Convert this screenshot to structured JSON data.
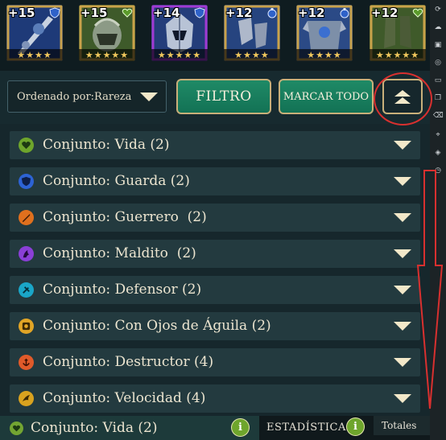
{
  "gear_items": [
    {
      "level": "+15",
      "stars": "★★★★",
      "set_icon": "shield-icon",
      "set_color": "#2f62c9",
      "frame": "#c9a24a"
    },
    {
      "level": "+15",
      "stars": "★★★★★",
      "set_icon": "heart-icon",
      "set_color": "#5b9a2b",
      "frame": "#c9a24a"
    },
    {
      "level": "+14",
      "stars": "★★★★★",
      "set_icon": "shield-icon",
      "set_color": "#2f62c9",
      "frame": "#a13ad1"
    },
    {
      "level": "+12",
      "stars": "★★★★",
      "set_icon": "potion-icon",
      "set_color": "#2f62c9",
      "frame": "#c9a24a"
    },
    {
      "level": "+12",
      "stars": "★★★★",
      "set_icon": "potion-icon",
      "set_color": "#2f62c9",
      "frame": "#c9a24a"
    },
    {
      "level": "+12",
      "stars": "★★★★★",
      "set_icon": "heart-icon",
      "set_color": "#5b9a2b",
      "frame": "#c9a24a"
    }
  ],
  "controls": {
    "sort_label": "Ordenado por:Rareza",
    "filter_label": "FILTRO",
    "mark_all_label": "MARCAR TODO"
  },
  "sets": [
    {
      "label": "Conjunto: Vida (2)",
      "icon": "heart-icon",
      "color": "#6ea52c"
    },
    {
      "label": "Conjunto: Guarda (2)",
      "icon": "shield-icon",
      "color": "#2d63d4"
    },
    {
      "label": "Conjunto: Guerrero  (2)",
      "icon": "sword-icon",
      "color": "#e0701e"
    },
    {
      "label": "Conjunto: Maldito  (2)",
      "icon": "curse-icon",
      "color": "#8a3fd6"
    },
    {
      "label": "Conjunto: Defensor (2)",
      "icon": "defender-icon",
      "color": "#1aa6c8"
    },
    {
      "label": "Conjunto: Con Ojos de Águila (2)",
      "icon": "eagle-eye-icon",
      "color": "#e2a526"
    },
    {
      "label": "Conjunto: Destructor (4)",
      "icon": "anchor-icon",
      "color": "#e05a2a"
    },
    {
      "label": "Conjunto: Velocidad (4)",
      "icon": "speed-icon",
      "color": "#d9a21f"
    }
  ],
  "bottom": {
    "selected_set": "Conjunto: Vida (2)",
    "info": "i",
    "stats_label": "ESTADÍSTICAS",
    "totals_label": "Totales"
  },
  "annotation_color": "#d8302f"
}
